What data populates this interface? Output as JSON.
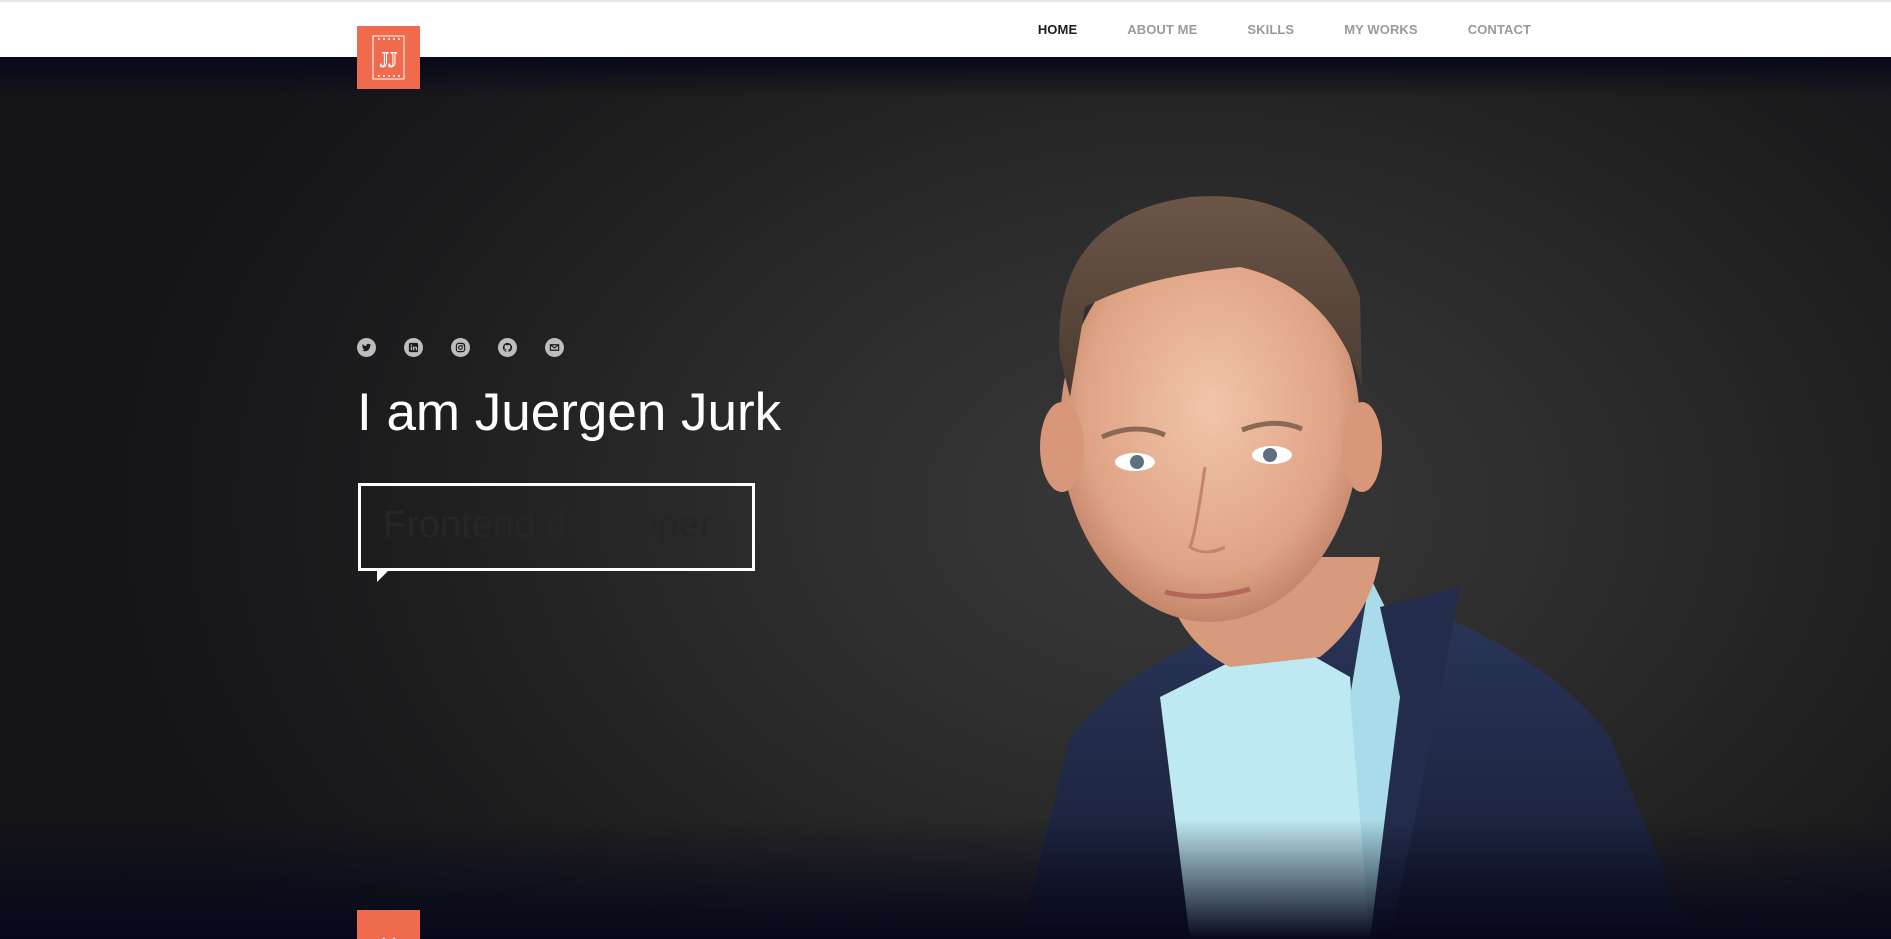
{
  "brand": {
    "logo_text": "JJ",
    "accent": "#f06a4e"
  },
  "nav": {
    "items": [
      {
        "label": "HOME",
        "active": true
      },
      {
        "label": "ABOUT ME",
        "active": false
      },
      {
        "label": "SKILLS",
        "active": false
      },
      {
        "label": "MY WORKS",
        "active": false
      },
      {
        "label": "CONTACT",
        "active": false
      }
    ]
  },
  "hero": {
    "socials": [
      "twitter-icon",
      "linkedin-icon",
      "instagram-icon",
      "github-icon",
      "gmail-icon"
    ],
    "title": "I am Juergen Jurk",
    "role": "Frontend developer",
    "scroll_icon": "chevron-down-icon"
  }
}
